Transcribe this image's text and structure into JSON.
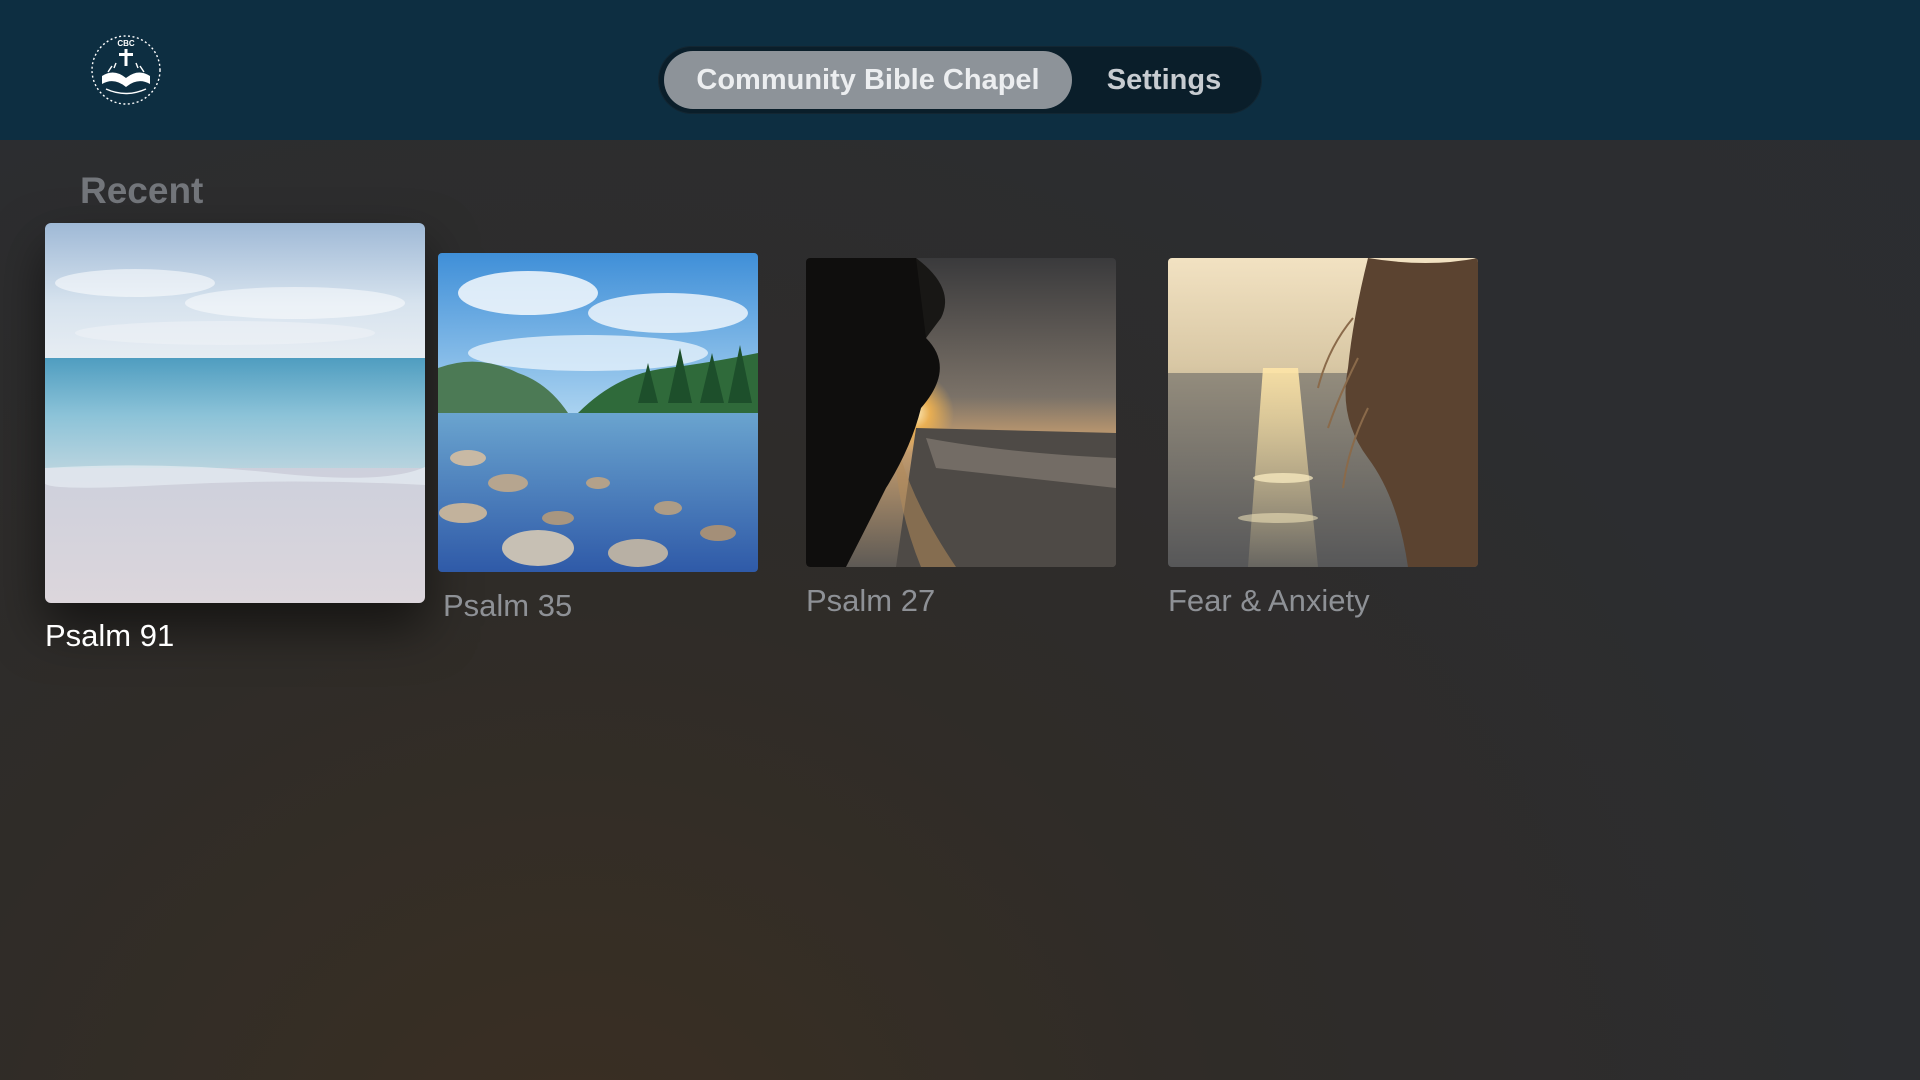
{
  "header": {
    "logo_name": "cbc-logo",
    "logo_text": "CBC",
    "logo_ring_text": "COMMUNITY BIBLE CHAPEL MISSIONS",
    "tabs": [
      {
        "label": "Community Bible Chapel",
        "selected": true
      },
      {
        "label": "Settings",
        "selected": false
      }
    ]
  },
  "recent": {
    "title": "Recent",
    "items": [
      {
        "title": "Psalm 91",
        "image": "calm-beach-sea",
        "focused": true
      },
      {
        "title": "Psalm 35",
        "image": "mountain-lake-rocks",
        "focused": false
      },
      {
        "title": "Psalm 27",
        "image": "sunset-shore-trees",
        "focused": false
      },
      {
        "title": "Fear & Anxiety",
        "image": "hair-sunlit-water",
        "focused": false
      }
    ]
  },
  "colors": {
    "topbar": "#0d2e41",
    "selected_tab": "#8d9399",
    "background": "#2c2d30"
  }
}
